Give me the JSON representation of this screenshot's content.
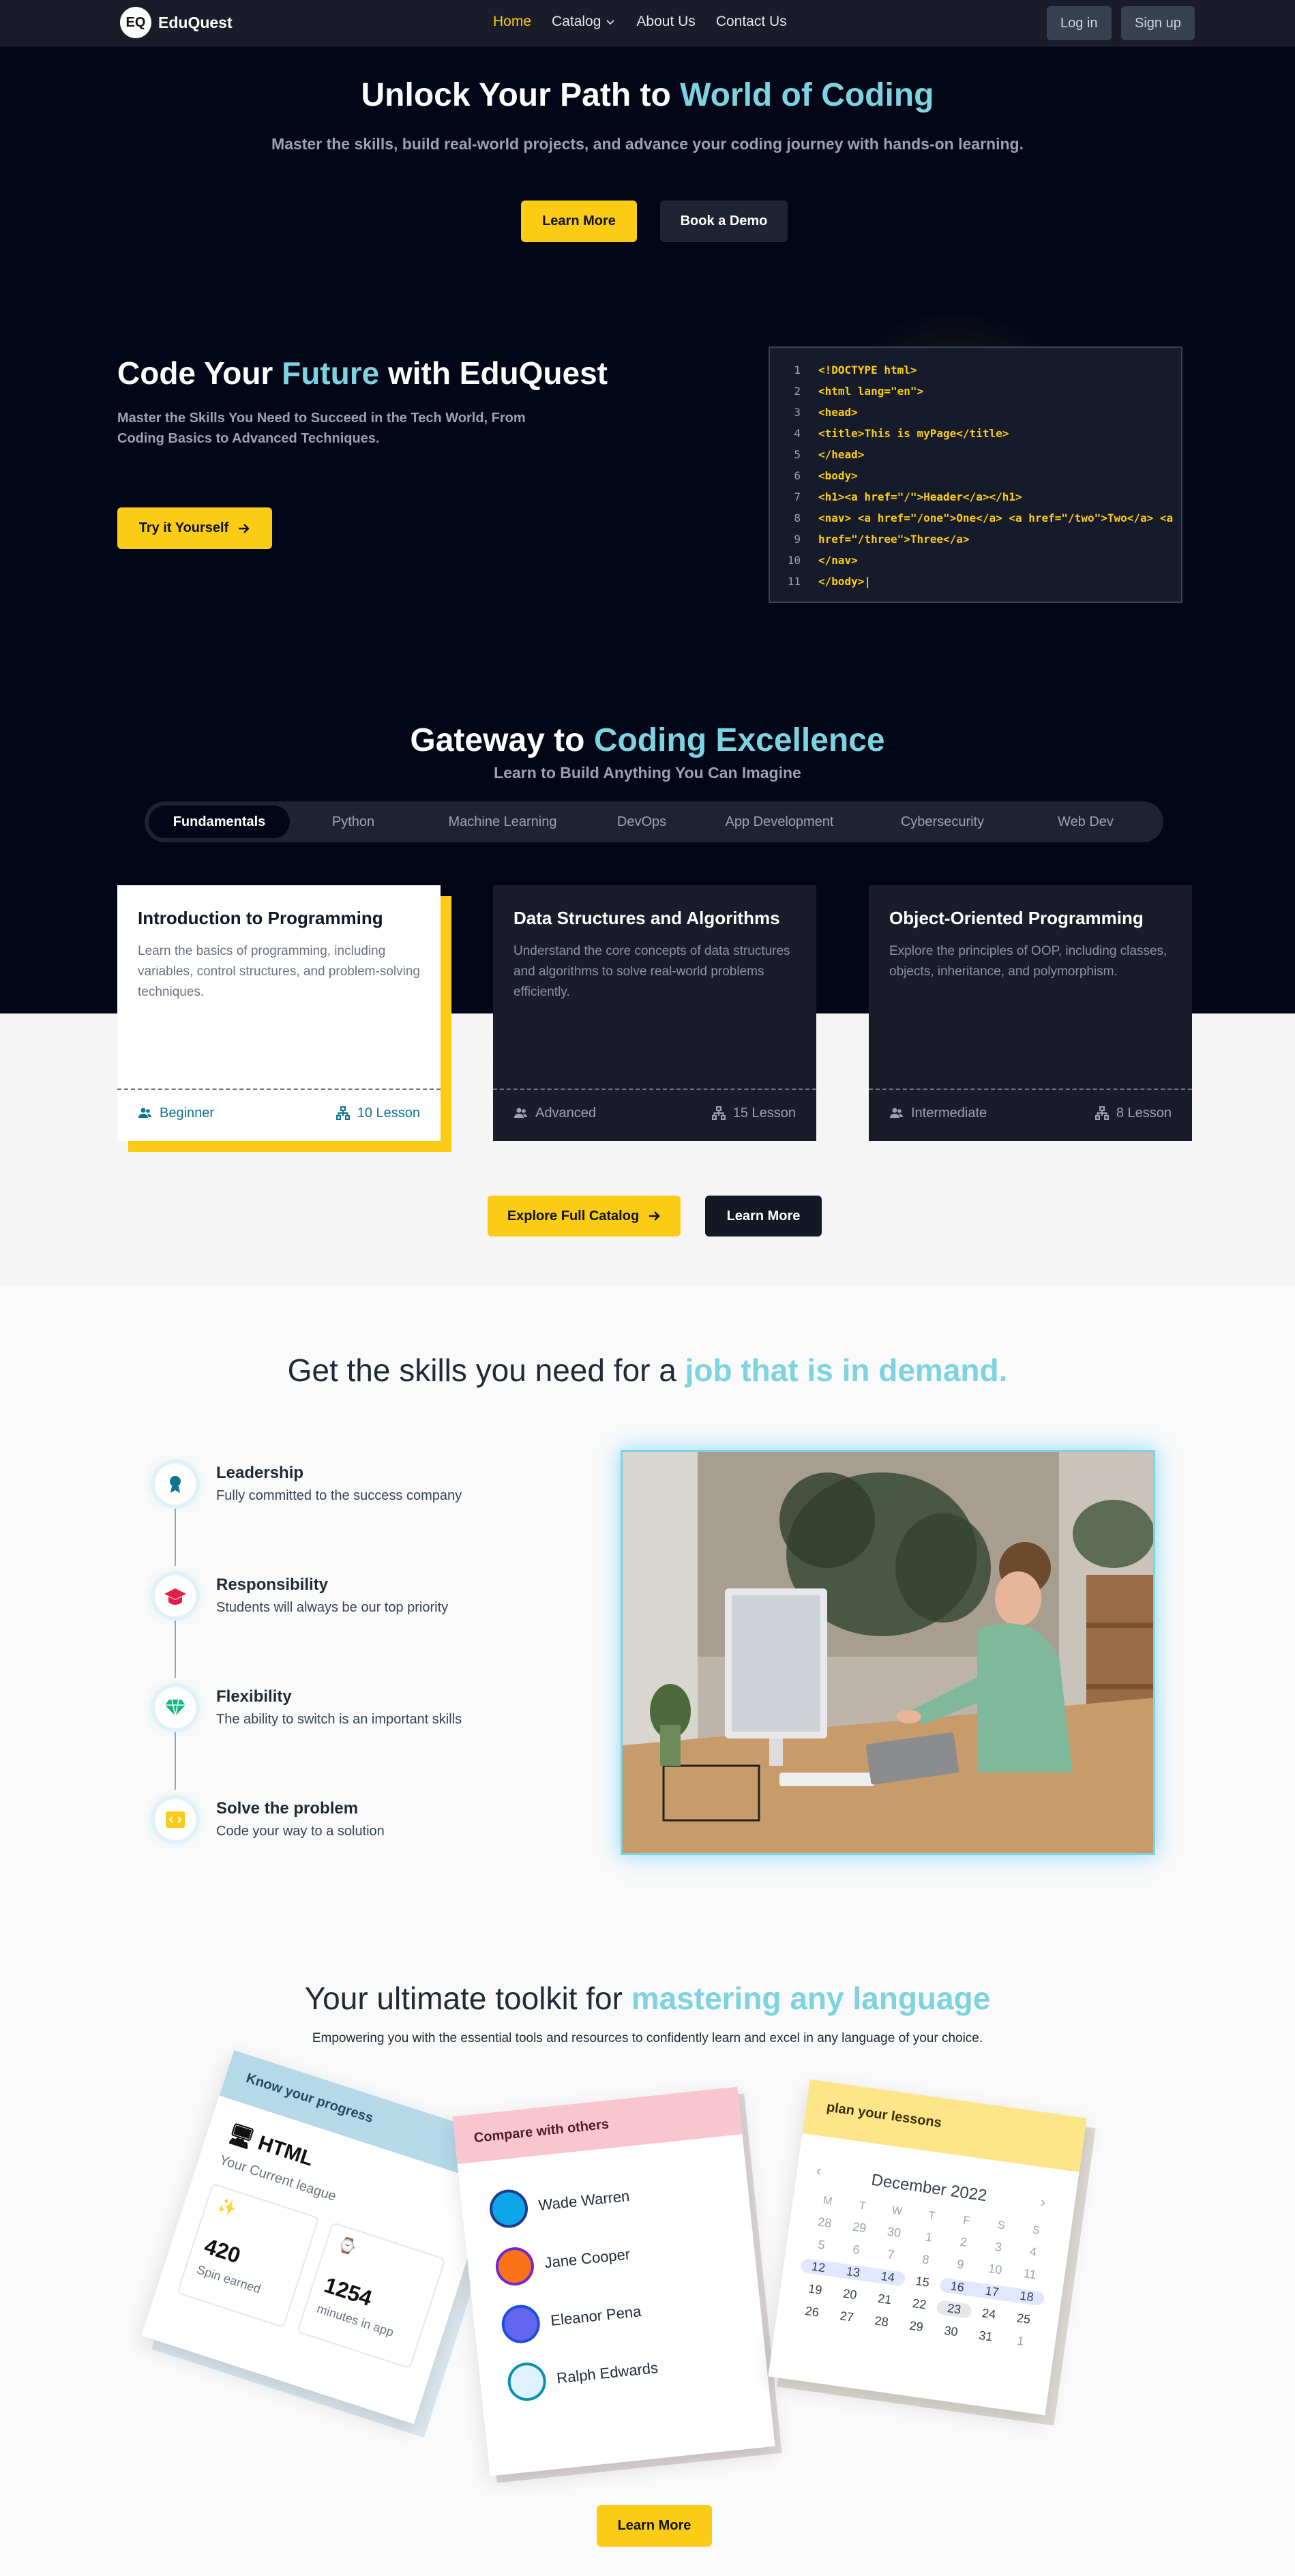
{
  "nav": {
    "logo_badge": "EQ",
    "logo_text": "EduQuest",
    "links": [
      "Home",
      "Catalog",
      "About Us",
      "Contact Us"
    ],
    "login": "Log in",
    "signup": "Sign up"
  },
  "hero": {
    "title_a": "Unlock Your Path to ",
    "title_b": "World of Coding",
    "subtitle": "Master the skills, build real-world projects, and advance your coding journey with hands-on learning.",
    "btn_learn": "Learn More",
    "btn_demo": "Book a Demo"
  },
  "future": {
    "title_a": "Code Your ",
    "title_b": "Future",
    "title_c": " with EduQuest",
    "desc": "Master the Skills You Need to Succeed in the Tech World, From Coding Basics to Advanced Techniques.",
    "btn": "Try it Yourself"
  },
  "code": {
    "lines": [
      {
        "n": "1",
        "t": "<!DOCTYPE html>"
      },
      {
        "n": "2",
        "t": "<html lang=\"en\">"
      },
      {
        "n": "3",
        "t": "<head>"
      },
      {
        "n": "4",
        "t": "<title>This is myPage</title>"
      },
      {
        "n": "5",
        "t": "</head>"
      },
      {
        "n": "6",
        "t": "<body>"
      },
      {
        "n": "7",
        "t": "<h1><a href=\"/\">Header</a></h1>"
      },
      {
        "n": "8",
        "t": "<nav> <a href=\"/one\">One</a> <a href=\"/two\">Two</a> <a"
      },
      {
        "n": "9",
        "t": "href=\"/three\">Three</a>"
      },
      {
        "n": "10",
        "t": "</nav>"
      },
      {
        "n": "11",
        "t": "</body>|"
      }
    ]
  },
  "gateway": {
    "title_a": "Gateway to ",
    "title_b": "Coding Excellence",
    "subtitle": "Learn to Build Anything You Can Imagine",
    "tabs": [
      "Fundamentals",
      "Python",
      "Machine Learning",
      "DevOps",
      "App Development",
      "Cybersecurity",
      "Web Dev"
    ]
  },
  "cards": [
    {
      "title": "Introduction to Programming",
      "desc": "Learn the basics of programming, including variables, control structures, and problem-solving techniques.",
      "level": "Beginner",
      "lessons": "10 Lesson"
    },
    {
      "title": "Data Structures and Algorithms",
      "desc": "Understand the core concepts of data structures and algorithms to solve real-world problems efficiently.",
      "level": "Advanced",
      "lessons": "15 Lesson"
    },
    {
      "title": "Object-Oriented Programming",
      "desc": "Explore the principles of OOP, including classes, objects, inheritance, and polymorphism.",
      "level": "Intermediate",
      "lessons": "8 Lesson"
    }
  ],
  "catalog": {
    "btn_catalog": "Explore Full Catalog",
    "btn_learn": "Learn More"
  },
  "skills": {
    "title_a": "Get the skills you need for a ",
    "title_b": "job that is in demand.",
    "items": [
      {
        "title": "Leadership",
        "desc": "Fully committed to the success company",
        "icon": "medal-icon"
      },
      {
        "title": "Responsibility",
        "desc": "Students will always be our top priority",
        "icon": "graduation-cap-icon"
      },
      {
        "title": "Flexibility",
        "desc": "The ability to switch is an important skills",
        "icon": "diamond-icon"
      },
      {
        "title": "Solve the problem",
        "desc": "Code your way to a solution",
        "icon": "code-icon"
      }
    ]
  },
  "toolkit": {
    "title_a": "Your ultimate toolkit for ",
    "title_b": "mastering any language",
    "subtitle": "Empowering you with the essential tools and resources to confidently learn and excel in any language of your choice.",
    "progress": {
      "header": "Know your progress",
      "lang": "HTML",
      "league": "Your Current league",
      "spin_value": "420",
      "spin_label": "Spin earned",
      "min_value": "1254",
      "min_label": "minutes in app"
    },
    "compare": {
      "header": "Compare with others",
      "people": [
        "Wade Warren",
        "Jane Cooper",
        "Eleanor Pena",
        "Ralph Edwards"
      ]
    },
    "plan": {
      "header": "plan your lessons",
      "month": "December 2022",
      "weekdays": [
        "M",
        "T",
        "W",
        "T",
        "F",
        "S",
        "S"
      ],
      "days": [
        "28",
        "29",
        "30",
        "1",
        "2",
        "3",
        "4",
        "5",
        "6",
        "7",
        "8",
        "9",
        "10",
        "11",
        "12",
        "13",
        "14",
        "15",
        "16",
        "17",
        "18",
        "19",
        "20",
        "21",
        "22",
        "23",
        "24",
        "25",
        "26",
        "27",
        "28",
        "29",
        "30",
        "31",
        "1"
      ]
    },
    "btn": "Learn More"
  },
  "colors": {
    "accent": "#facc15",
    "cyan": "#7dd3e0",
    "dark": "#020617",
    "card": "#1a1d29"
  }
}
